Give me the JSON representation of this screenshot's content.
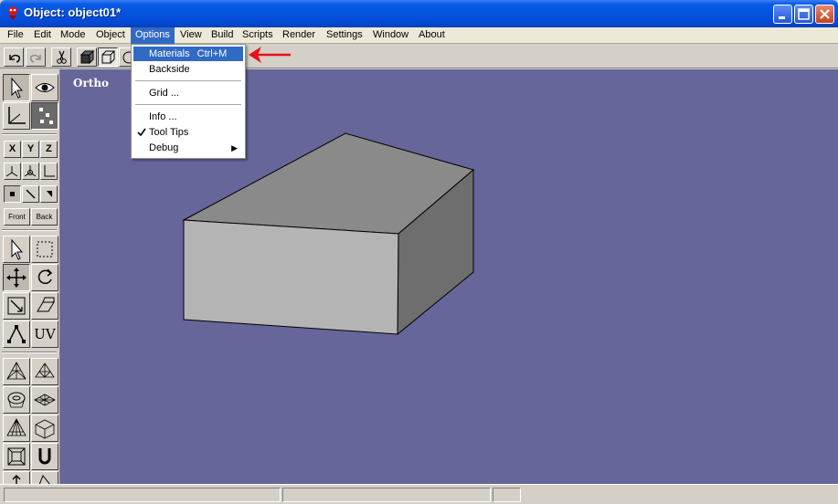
{
  "window": {
    "title": "Object: object01*"
  },
  "menubar": {
    "items": [
      {
        "label": "File"
      },
      {
        "label": "Edit"
      },
      {
        "label": "Mode"
      },
      {
        "label": "Object"
      },
      {
        "label": "Options"
      },
      {
        "label": "View"
      },
      {
        "label": "Build"
      },
      {
        "label": "Scripts"
      },
      {
        "label": "Render"
      },
      {
        "label": "Settings"
      },
      {
        "label": "Window"
      },
      {
        "label": "About"
      }
    ],
    "active": "Options"
  },
  "options_menu": {
    "materials": {
      "label": "Materials",
      "shortcut": "Ctrl+M"
    },
    "backside": {
      "label": "Backside"
    },
    "grid": {
      "label": "Grid ..."
    },
    "info": {
      "label": "Info ..."
    },
    "tooltips": {
      "label": "Tool Tips",
      "checked": true
    },
    "debug": {
      "label": "Debug"
    }
  },
  "palette": {
    "x_label": "X",
    "y_label": "Y",
    "z_label": "Z",
    "front_label": "Front",
    "back_label": "Back",
    "uv_label": "UV"
  },
  "viewport": {
    "label": "Ortho",
    "background": "#66669a"
  },
  "colors": {
    "menu_highlight": "#316ac5",
    "annotation_arrow": "#e8101a",
    "cube_front": "#b4b4b4",
    "cube_top": "#8a8a8a",
    "cube_side": "#6e6e6e"
  }
}
